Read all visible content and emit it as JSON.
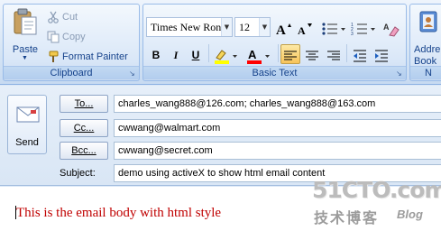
{
  "ribbon": {
    "clipboard": {
      "paste_label": "Paste",
      "cut_label": "Cut",
      "copy_label": "Copy",
      "format_painter_label": "Format Painter",
      "group_label": "Clipboard"
    },
    "basic_text": {
      "font_name": "Times New Ron",
      "font_size": "12",
      "group_label": "Basic Text",
      "grow_font_icon": "grow-font-icon",
      "shrink_font_icon": "shrink-font-icon",
      "bullets_icon": "bullets-icon",
      "numbering_icon": "numbering-icon",
      "clear_formatting_icon": "clear-formatting-icon",
      "bold_label": "B",
      "italic_label": "I",
      "underline_label": "U",
      "highlight_color": "#ffff00",
      "font_color": "#ff0000",
      "active_alignment": "align-left"
    },
    "names": {
      "address_book_label": "Addre Book",
      "group_label": "N"
    }
  },
  "compose": {
    "send_label": "Send",
    "to_button": "To...",
    "cc_button": "Cc...",
    "bcc_button": "Bcc...",
    "subject_label": "Subject:",
    "to_value": "charles_wang888@126.com; charles_wang888@163.com",
    "cc_value": "cwwang@walmart.com",
    "bcc_value": "cwwang@secret.com",
    "subject_value": "demo using activeX to show html email content"
  },
  "body": {
    "text": "This is the email body with html style",
    "text_color": "#c00000"
  },
  "watermark": {
    "main": "51CTO.com",
    "sub": "技术博客",
    "blog": "Blog"
  }
}
